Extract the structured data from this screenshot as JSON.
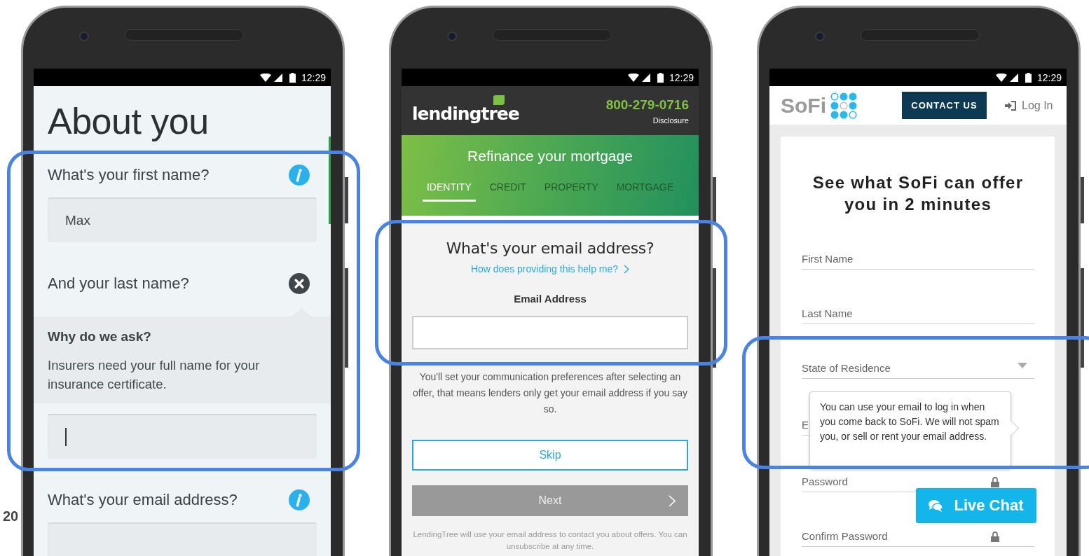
{
  "about_you": {
    "status_time": "12:29",
    "title": "About you",
    "page_fragment": "20",
    "questions": [
      {
        "label": "What's your first name?",
        "expanded": false,
        "value": "Max",
        "focused": false
      },
      {
        "label": "And your last name?",
        "expanded": true,
        "help_title": "Why do we ask?",
        "help_text": "Insurers need your full name for your insurance certificate.",
        "focused": true
      },
      {
        "label": "What's your email address?",
        "expanded": false,
        "focused": false
      }
    ]
  },
  "lendingtree": {
    "status_time": "12:29",
    "logo": "lendingtree",
    "phone": "800-279-0716",
    "disclosure": "Disclosure",
    "banner_title": "Refinance your mortgage",
    "steps": [
      {
        "label": "IDENTITY",
        "selected": true
      },
      {
        "label": "CREDIT",
        "selected": false
      },
      {
        "label": "PROPERTY",
        "selected": false
      },
      {
        "label": "MORTGAGE",
        "selected": false
      }
    ],
    "heading": "What's your email address?",
    "help_link": "How does providing this help me?",
    "field_label": "Email Address",
    "note": "You'll set your communication preferences after selecting an offer, that means lenders only get your email address if you say so.",
    "buttons": [
      {
        "label": "Skip",
        "kind": "outline",
        "disabled": false
      },
      {
        "label": "Next",
        "kind": "arrow",
        "disabled": true
      }
    ],
    "footnote": "LendingTree will use your email address to contact you about offers. You can unsubscribe at any time."
  },
  "sofi": {
    "status_time": "12:29",
    "logo": "SoFi",
    "contact_button": "CONTACT US",
    "login_link": "Log In",
    "heading": "See what SoFi can offer you in 2 minutes",
    "fields": [
      {
        "label": "First Name",
        "kind": "text",
        "info": false
      },
      {
        "label": "Last Name",
        "kind": "text",
        "info": false
      },
      {
        "label": "State of Residence",
        "kind": "select",
        "info": false
      },
      {
        "label": "E",
        "kind": "text",
        "info": true,
        "tooltip": "You can use your email to log in when you come back to SoFi. We will not spam you, or sell or rent your email address."
      },
      {
        "label": "Password",
        "kind": "password",
        "info": true
      },
      {
        "label": "Confirm Password",
        "kind": "password",
        "info": false
      }
    ],
    "chat_button": "Live Chat"
  }
}
